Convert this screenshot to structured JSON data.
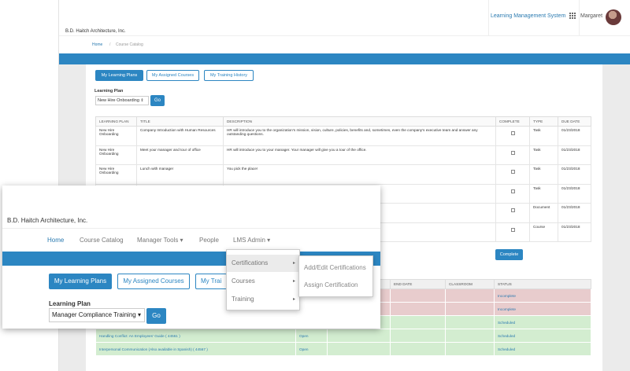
{
  "back": {
    "company": "B.D. Haitch Architecture, Inc.",
    "app_title": "Learning Management System",
    "user_name": "Margaret",
    "breadcrumb": {
      "home": "Home",
      "sep": "/",
      "current": "Course Catalog"
    },
    "tabs": [
      "My Learning Plans",
      "My Assigned Courses",
      "My Training History"
    ],
    "learning_plan_label": "Learning Plan",
    "learning_plan_value": "New Hire Onboarding",
    "go_label": "Go",
    "table_headers": [
      "LEARNING PLAN",
      "TITLE",
      "DESCRIPTION",
      "COMPLETE",
      "TYPE",
      "DUE DATE"
    ],
    "rows": [
      {
        "plan": "New Hire Onboarding",
        "title": "Company Introduction with Human Resources",
        "desc": "HR will introduce you to the organization's mission, vision, culture, policies, benefits and, sometimes, even the company's executive team and answer any outstanding questions.",
        "type": "Task",
        "due": "01/23/2018"
      },
      {
        "plan": "New Hire Onboarding",
        "title": "Meet your manager and tour of office",
        "desc": "HR will introduce you to your manager. Your manager will give you a tour of the office.",
        "type": "Task",
        "due": "01/23/2018"
      },
      {
        "plan": "New Hire Onboarding",
        "title": "Lunch with manager",
        "desc": "You pick the place!",
        "type": "Task",
        "due": "01/23/2018"
      },
      {
        "plan": "",
        "title": "",
        "desc": "",
        "type": "Task",
        "due": "01/23/2018"
      },
      {
        "plan": "",
        "title": "",
        "desc": "",
        "type": "Document",
        "due": "01/23/2018"
      },
      {
        "plan": "",
        "title": "",
        "desc": "",
        "type": "Course",
        "due": "01/23/2018"
      }
    ],
    "complete_button": "Complete",
    "schedule_headers": [
      "START DATE",
      "END DATE",
      "CLASSROOM",
      "STATUS"
    ],
    "schedule_rows": [
      {
        "course": "",
        "open": "",
        "status": "Incomplete",
        "color": "pink"
      },
      {
        "course": "",
        "open": "",
        "status": "Incomplete",
        "color": "pink"
      },
      {
        "course": "",
        "open": "",
        "status": "Scheduled",
        "color": "green"
      },
      {
        "course": "Handling Conflict: An Employees' Guide ( 44561 )",
        "open": "Open",
        "status": "Scheduled",
        "color": "green"
      },
      {
        "course": "Interpersonal Communication (Also available in Spanish) ( 44567 )",
        "open": "Open",
        "status": "Scheduled",
        "color": "green"
      }
    ]
  },
  "front": {
    "company": "B.D. Haitch Architecture, Inc.",
    "nav": {
      "home": "Home",
      "catalog": "Course Catalog",
      "manager_tools": "Manager Tools ▾",
      "people": "People",
      "lms_admin": "LMS Admin ▾"
    },
    "tabs": [
      "My Learning Plans",
      "My Assigned Courses",
      "My Trai"
    ],
    "learning_plan_label": "Learning Plan",
    "learning_plan_value": "Manager Compliance Training ▾",
    "go_label": "Go",
    "menu": [
      {
        "label": "Certifications",
        "arrow": "▸"
      },
      {
        "label": "Courses",
        "arrow": "▸"
      },
      {
        "label": "Training",
        "arrow": "▸"
      }
    ],
    "submenu": [
      "Add/Edit Certifications",
      "Assign Certification"
    ]
  },
  "colors": {
    "primary": "#2c86c2",
    "incomplete_row": "#e8cccd",
    "scheduled_row": "#d3edd0"
  }
}
